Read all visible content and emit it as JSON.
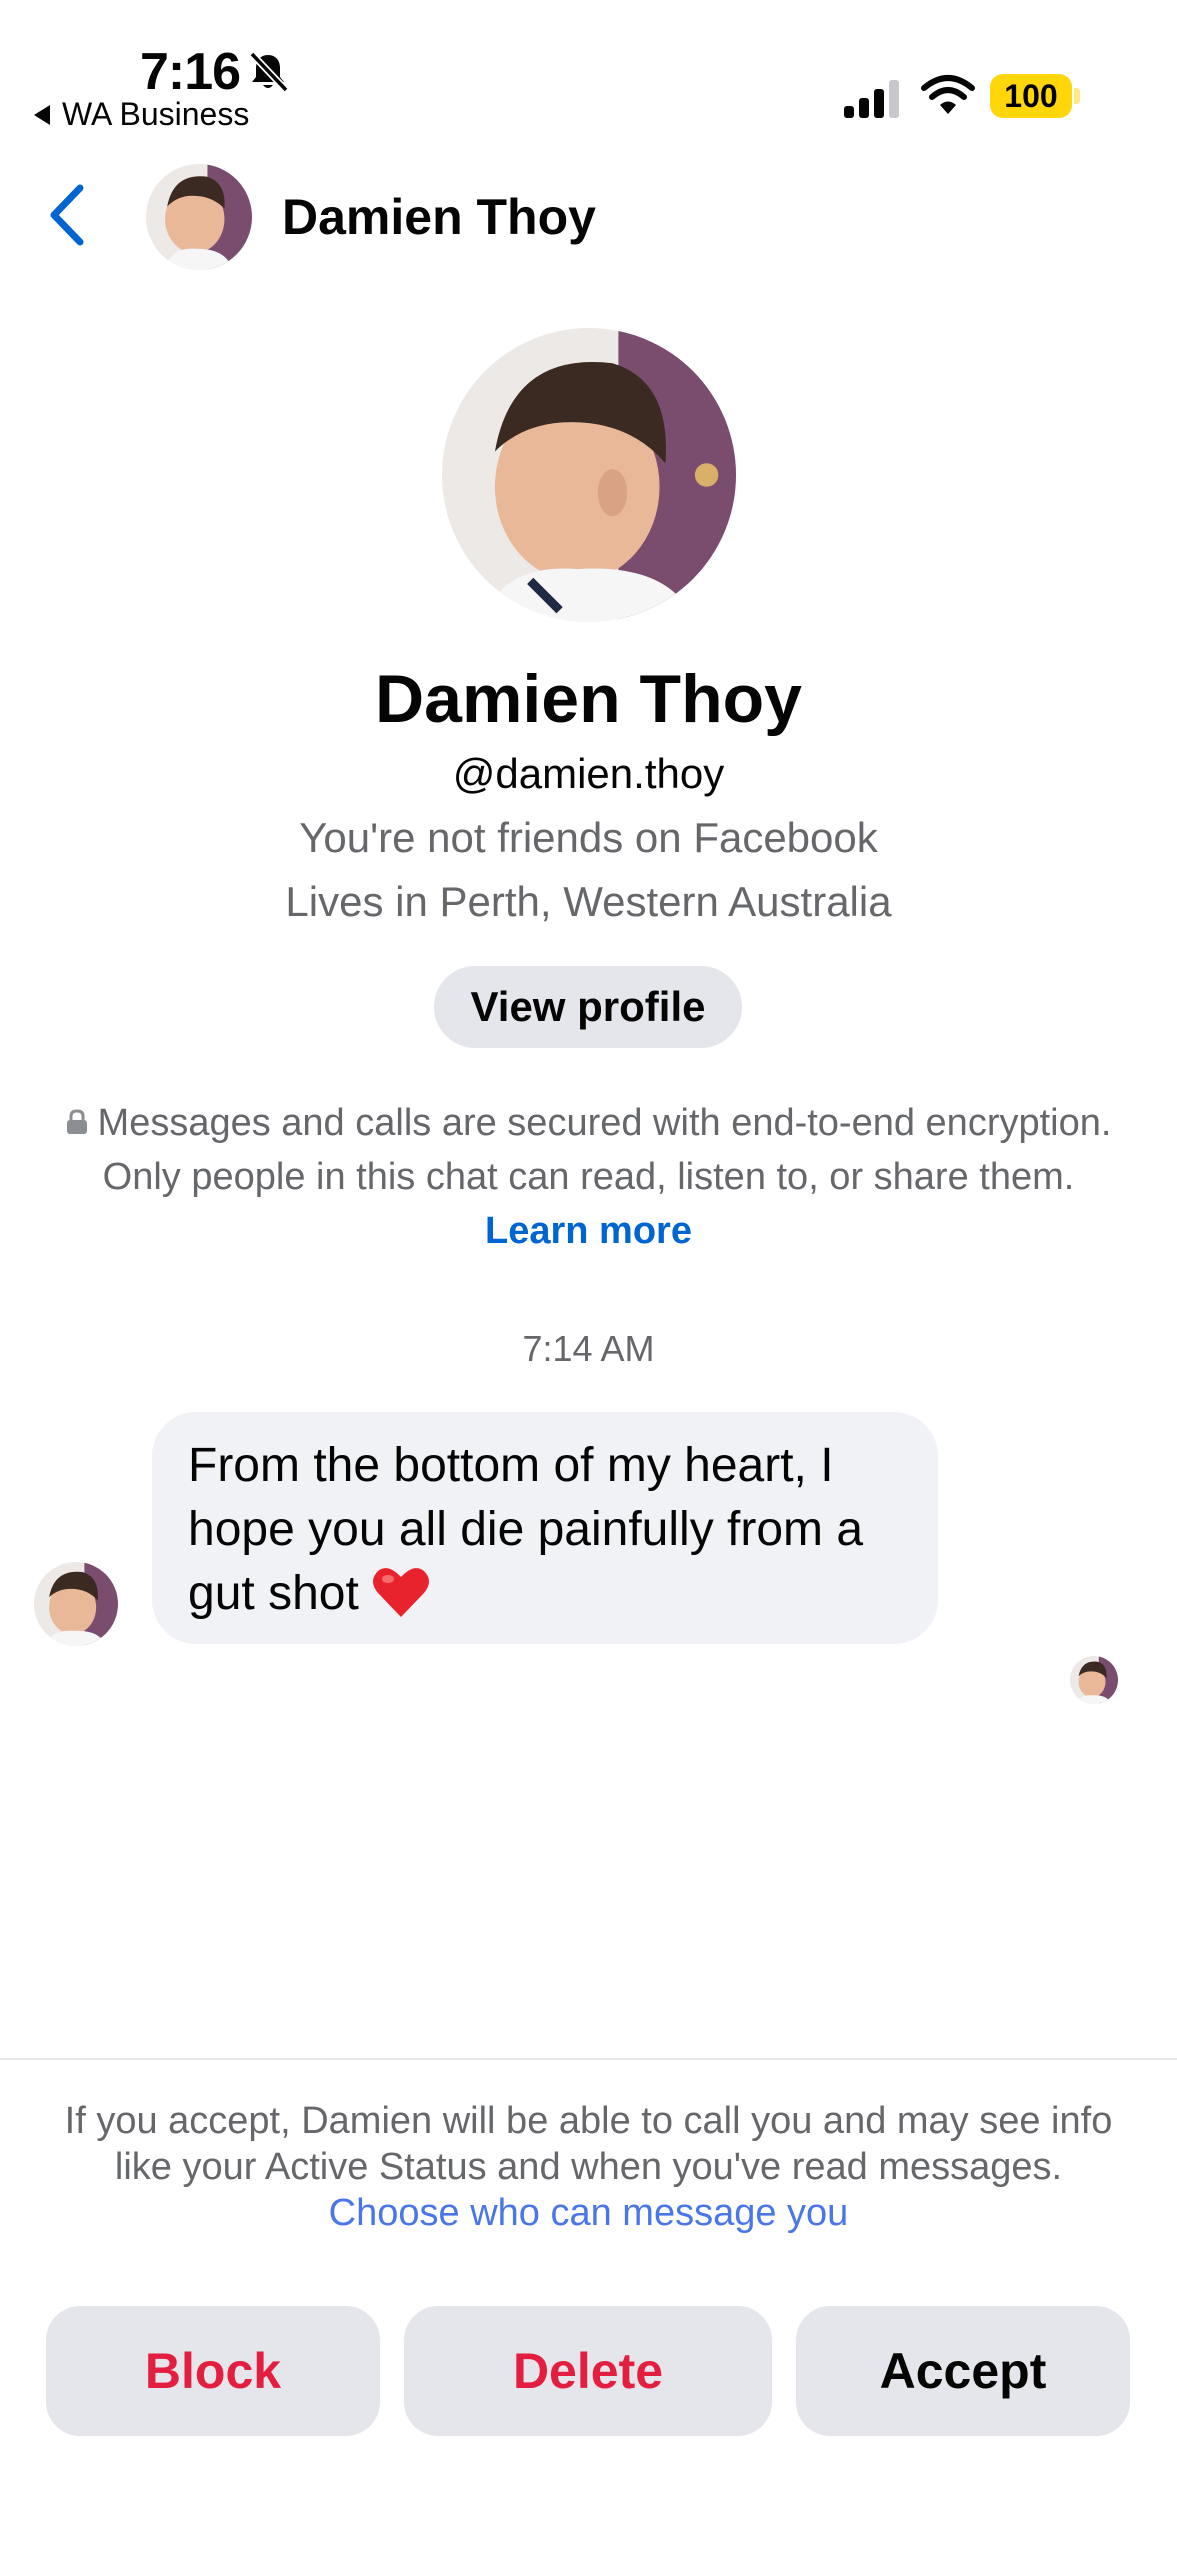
{
  "status_bar": {
    "time": "7:16",
    "back_app": "WA Business",
    "battery": "100"
  },
  "header": {
    "contact_name": "Damien Thoy"
  },
  "profile": {
    "name": "Damien Thoy",
    "username": "@damien.thoy",
    "friend_status": "You're not friends on Facebook",
    "location": "Lives in Perth, Western Australia",
    "view_profile_label": "View profile"
  },
  "encryption": {
    "text": "Messages and calls are secured with end-to-end encryption. Only people in this chat can read, listen to, or share them.",
    "link": "Learn more"
  },
  "conversation": {
    "timestamp": "7:14 AM",
    "messages": [
      {
        "text": "From the bottom of my heart, I hope you all die painfully from a gut shot",
        "emoji": "heart"
      }
    ]
  },
  "request_notice": {
    "text": "If you accept, Damien will be able to call you and may see info like your Active Status and when you've read messages.",
    "link": "Choose who can message you"
  },
  "actions": {
    "block": "Block",
    "delete": "Delete",
    "accept": "Accept"
  },
  "colors": {
    "accent": "#0064d1",
    "danger": "#e41e3f",
    "battery": "#ffd60a"
  }
}
